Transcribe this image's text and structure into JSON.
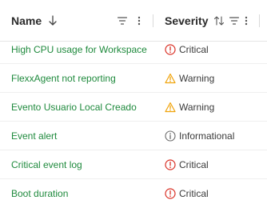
{
  "columns": {
    "name": {
      "label": "Name",
      "sort": "descending",
      "sort_icon": "arrow-down-icon",
      "filter_icon": "filter-icon",
      "menu_icon": "more-vertical-icon"
    },
    "severity": {
      "label": "Severity",
      "sort": "unsorted",
      "sort_icon": "sort-up-down-icon",
      "filter_icon": "filter-icon",
      "menu_icon": "more-vertical-icon"
    }
  },
  "rows": [
    {
      "name": "High CPU usage for Workspace",
      "severity": "Critical",
      "severity_icon": "alert-circle-icon"
    },
    {
      "name": "FlexxAgent not reporting",
      "severity": "Warning",
      "severity_icon": "warning-triangle-icon"
    },
    {
      "name": "Evento Usuario Local Creado",
      "severity": "Warning",
      "severity_icon": "warning-triangle-icon"
    },
    {
      "name": "Event alert",
      "severity": "Informational",
      "severity_icon": "info-circle-icon"
    },
    {
      "name": "Critical event log",
      "severity": "Critical",
      "severity_icon": "alert-circle-icon"
    },
    {
      "name": "Boot duration",
      "severity": "Critical",
      "severity_icon": "alert-circle-icon"
    }
  ],
  "colors": {
    "link": "#1f8a3d",
    "critical": "#d93025",
    "warning": "#f0a30a",
    "informational": "#6b6b6b",
    "header_text": "#2b2b2b",
    "border": "#e6e6e6"
  }
}
